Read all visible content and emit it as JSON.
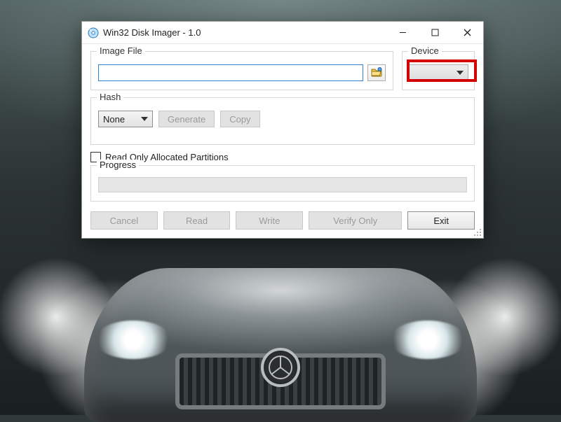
{
  "window": {
    "title": "Win32 Disk Imager - 1.0"
  },
  "image_file": {
    "legend": "Image File",
    "value": ""
  },
  "device": {
    "legend": "Device",
    "selected": ""
  },
  "hash": {
    "legend": "Hash",
    "selected": "None",
    "generate_label": "Generate",
    "copy_label": "Copy"
  },
  "read_only": {
    "label": "Read Only Allocated Partitions",
    "checked": false
  },
  "progress": {
    "legend": "Progress"
  },
  "buttons": {
    "cancel": "Cancel",
    "read": "Read",
    "write": "Write",
    "verify": "Verify Only",
    "exit": "Exit"
  },
  "icons": {
    "app": "disc-app-icon",
    "browse": "folder-open-icon",
    "minimize": "minimize-icon",
    "maximize": "maximize-icon",
    "close": "close-icon"
  }
}
